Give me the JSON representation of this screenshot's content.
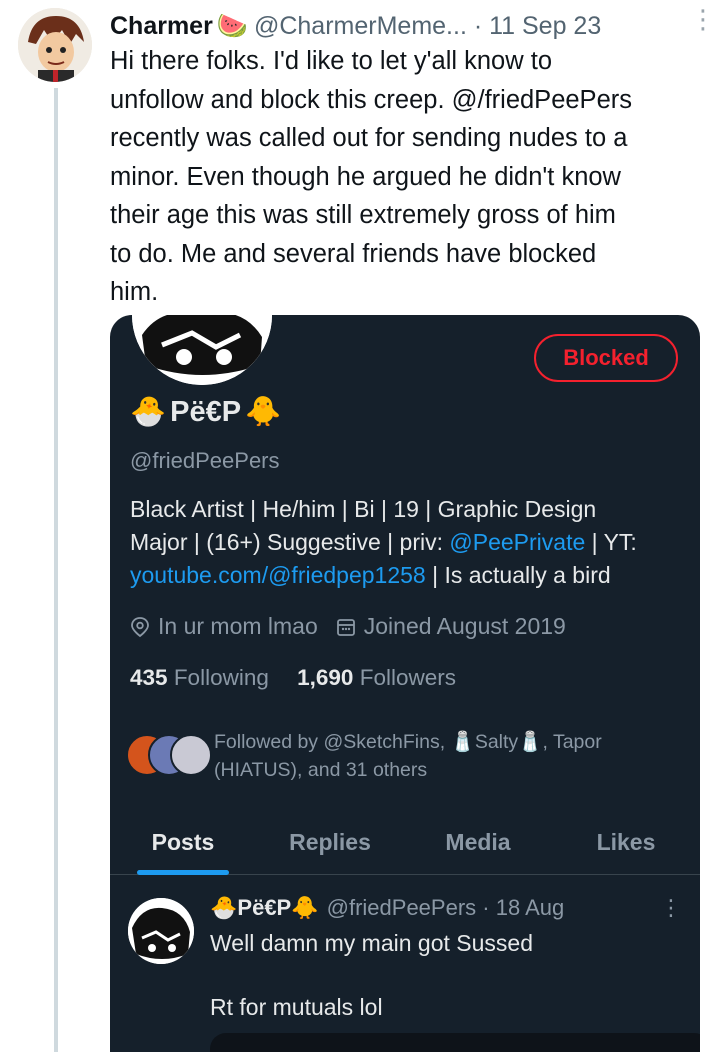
{
  "tweet": {
    "author_name": "Charmer",
    "name_emoji": "🍉",
    "author_handle": "@CharmerMeme...",
    "separator": " · ",
    "date": "11 Sep 23",
    "more": "⋮",
    "text_lines": [
      "Hi there folks. I'd like to let y'all know to",
      "unfollow and block this creep. @/friedPeePers",
      "recently was called out for sending nudes to a",
      "minor. Even though he argued he didn't know",
      "their age this was still extremely gross of him",
      "to do. Me and several friends have blocked",
      "him."
    ]
  },
  "profile_card": {
    "blocked_label": "Blocked",
    "display_name": "Pë€P",
    "name_emoji_left": "🐣",
    "name_emoji_right": "🐥",
    "handle": "@friedPeePers",
    "bio": {
      "line1": "Black Artist | He/him | Bi | 19 | Graphic Design",
      "line2_a": "Major | (16+) Suggestive | priv: ",
      "line2_link": "@PeePrivate",
      "line2_b": " | YT:",
      "line3_link": "youtube.com/@friedpep1258",
      "line3_b": " | Is actually a bird"
    },
    "location": "In ur mom lmao",
    "joined": "Joined August 2019",
    "following_count": "435",
    "following_label": "Following",
    "followers_count": "1,690",
    "followers_label": "Followers",
    "followed_by_line1": "Followed by @SketchFins, 🧂Salty🧂, Tapor",
    "followed_by_line2": "(HIATUS), and 31 others",
    "tabs": [
      "Posts",
      "Replies",
      "Media",
      "Likes"
    ],
    "active_tab": "Posts"
  },
  "pinned_post": {
    "name": "Pë€P",
    "name_emoji_left": "🐣",
    "name_emoji_right": "🐥",
    "handle": "@friedPeePers",
    "separator": " · ",
    "date": "18 Aug",
    "more": "⋮",
    "line1": "Well damn my main got Sussed",
    "line2": "Rt for mutuals lol"
  },
  "colors": {
    "card_bg": "#15202b",
    "link": "#1d9bf0",
    "blocked": "#f4212e",
    "muted": "#8b98a5"
  }
}
